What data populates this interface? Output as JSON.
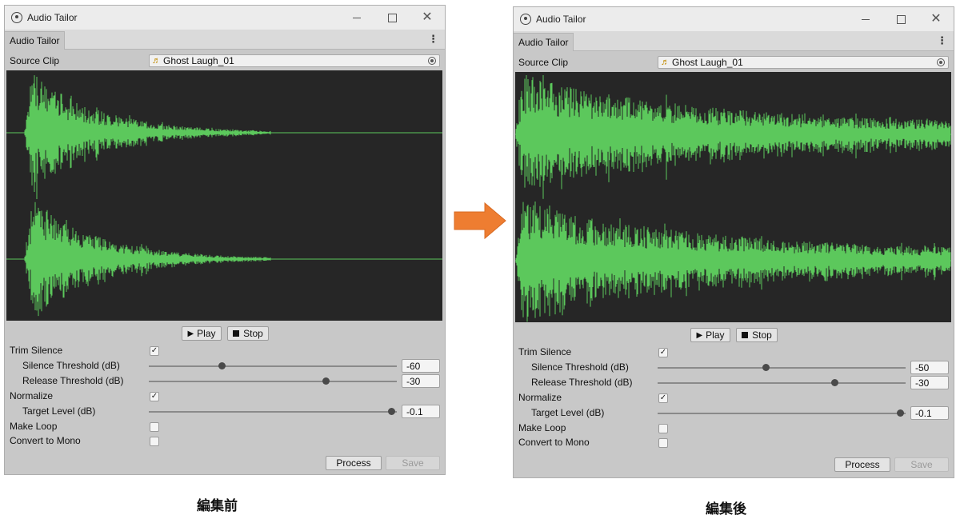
{
  "caption_before": "編集前",
  "caption_after": "編集後",
  "colors": {
    "waveform": "#5cc85c",
    "waveform_bg": "#262626",
    "arrow": "#ee7d31"
  },
  "windows": [
    {
      "title": "Audio Tailor",
      "tab": "Audio Tailor",
      "source_clip_label": "Source Clip",
      "source_clip_value": "Ghost Laugh_01",
      "play_label": "Play",
      "stop_label": "Stop",
      "trim_silence_label": "Trim Silence",
      "trim_silence_checked": "✓",
      "silence_threshold_label": "Silence Threshold (dB)",
      "silence_threshold_value": "-60",
      "release_threshold_label": "Release Threshold (dB)",
      "release_threshold_value": "-30",
      "normalize_label": "Normalize",
      "normalize_checked": "✓",
      "target_level_label": "Target Level (dB)",
      "target_level_value": "-0.1",
      "make_loop_label": "Make Loop",
      "convert_mono_label": "Convert to Mono",
      "process_label": "Process",
      "save_label": "Save"
    },
    {
      "title": "Audio Tailor",
      "tab": "Audio Tailor",
      "source_clip_label": "Source Clip",
      "source_clip_value": "Ghost Laugh_01",
      "play_label": "Play",
      "stop_label": "Stop",
      "trim_silence_label": "Trim Silence",
      "trim_silence_checked": "✓",
      "silence_threshold_label": "Silence Threshold (dB)",
      "silence_threshold_value": "-50",
      "release_threshold_label": "Release Threshold (dB)",
      "release_threshold_value": "-30",
      "normalize_label": "Normalize",
      "normalize_checked": "✓",
      "target_level_label": "Target Level (dB)",
      "target_level_value": "-0.1",
      "make_loop_label": "Make Loop",
      "convert_mono_label": "Convert to Mono",
      "process_label": "Process",
      "save_label": "Save"
    }
  ]
}
